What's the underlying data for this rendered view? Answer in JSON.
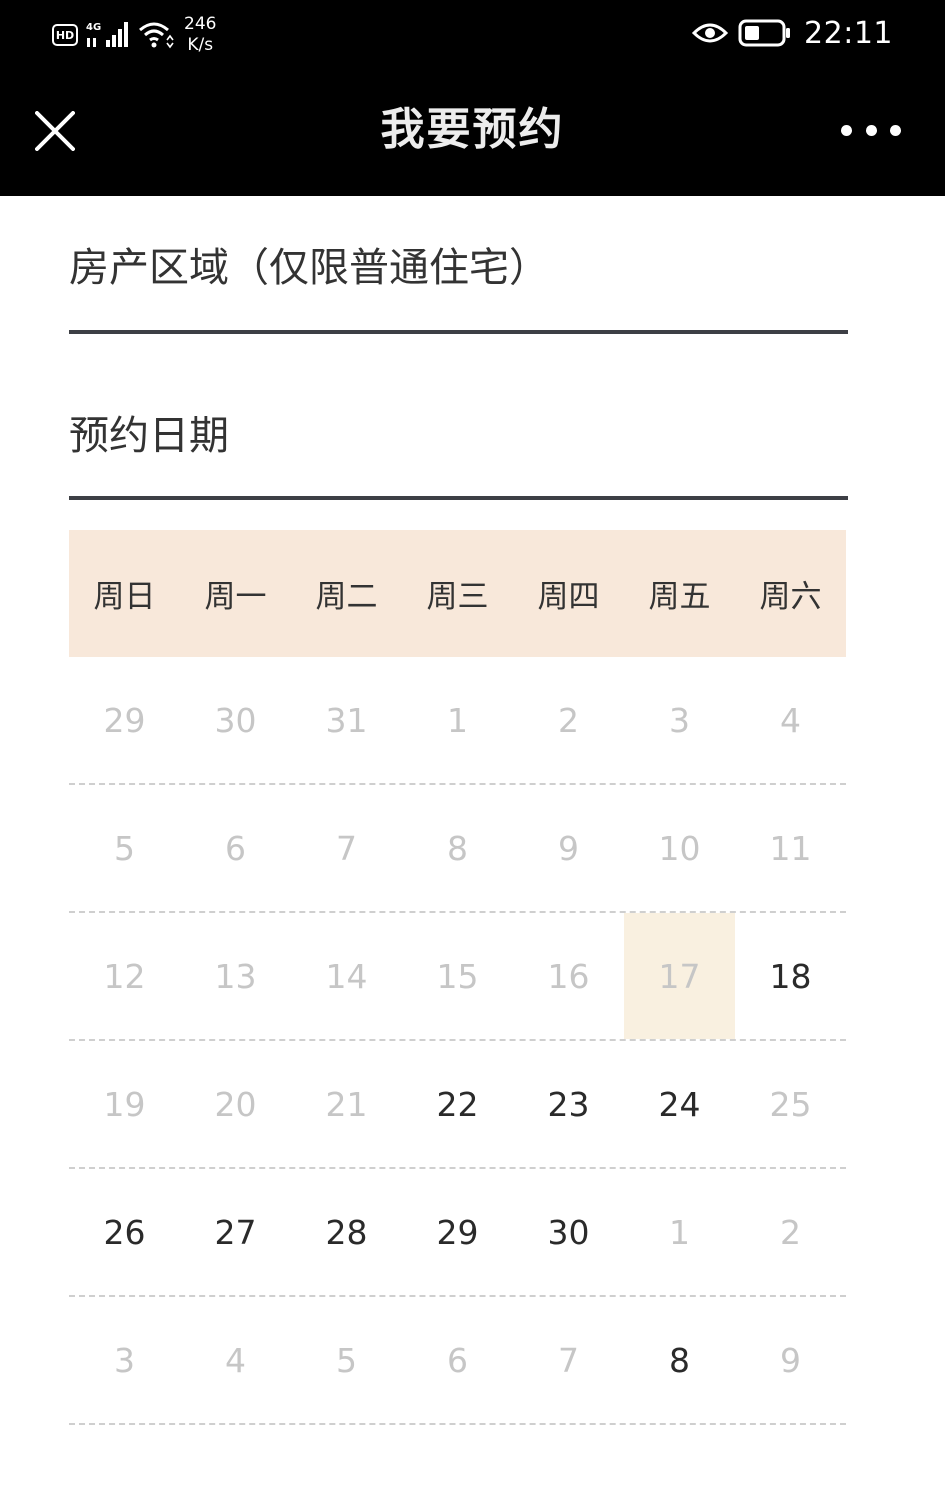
{
  "status_bar": {
    "hd_badge": "HD",
    "network_type": "4G",
    "net_speed_value": "246",
    "net_speed_unit": "K/s",
    "time": "22:11"
  },
  "nav": {
    "title": "我要预约"
  },
  "form": {
    "region_label": "房产区域（仅限普通住宅）",
    "date_label": "预约日期"
  },
  "calendar": {
    "weekdays": [
      "周日",
      "周一",
      "周二",
      "周三",
      "周四",
      "周五",
      "周六"
    ],
    "weeks": [
      [
        "29",
        "30",
        "31",
        "1",
        "2",
        "3",
        "4"
      ],
      [
        "5",
        "6",
        "7",
        "8",
        "9",
        "10",
        "11"
      ],
      [
        "12",
        "13",
        "14",
        "15",
        "16",
        "17",
        "18"
      ],
      [
        "19",
        "20",
        "21",
        "22",
        "23",
        "24",
        "25"
      ],
      [
        "26",
        "27",
        "28",
        "29",
        "30",
        "1",
        "2"
      ],
      [
        "3",
        "4",
        "5",
        "6",
        "7",
        "8",
        "9"
      ]
    ],
    "today": "17",
    "colors": {
      "header_bg": "#f8e8da",
      "today_bg": "#f9f0e0",
      "available_text": "#2a2a2a",
      "unavailable_text": "#c6c6c6"
    }
  }
}
